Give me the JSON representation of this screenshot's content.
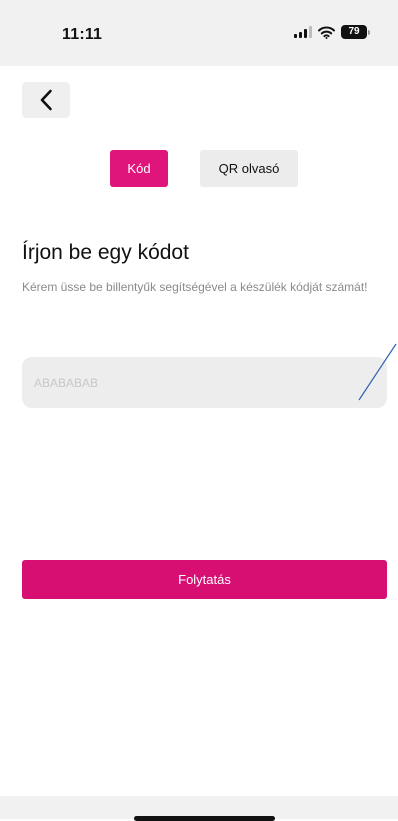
{
  "status_bar": {
    "time": "11:11",
    "battery_level": "79",
    "icons": [
      "signal-icon",
      "wifi-icon",
      "battery-icon"
    ]
  },
  "nav": {
    "back_icon": "chevron-left-icon"
  },
  "tabs": {
    "code_label": "Kód",
    "qr_label": "QR olvasó",
    "active": "code"
  },
  "main": {
    "heading": "Írjon be egy kódot",
    "description": "Kérem üsse be billentyűk segítségével a készülék kódját számát!",
    "input_placeholder": "ABABABAB",
    "input_value": ""
  },
  "actions": {
    "continue_label": "Folytatás"
  },
  "colors": {
    "accent": "#e0157c",
    "button": "#d80f73",
    "input_bg": "#ededed",
    "secondary_tab_bg": "#ececec"
  }
}
